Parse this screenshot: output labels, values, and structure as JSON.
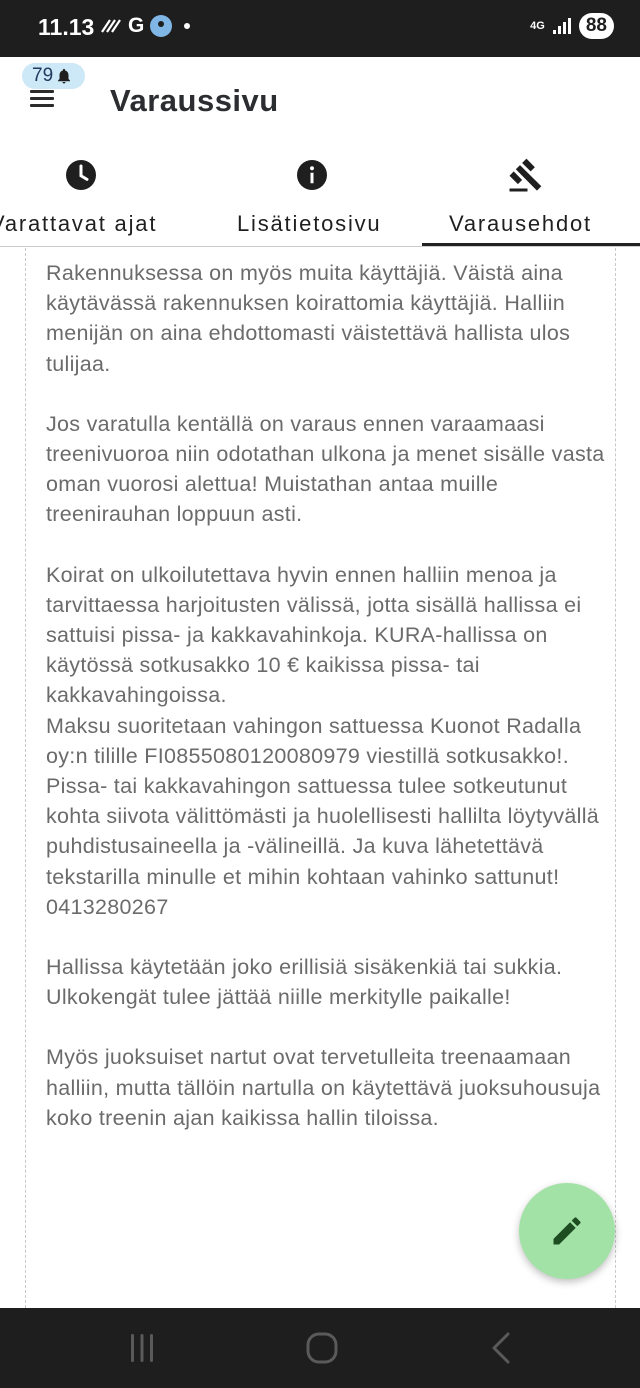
{
  "status_bar": {
    "time": "11.13",
    "left_icons": [
      "data-saver-icon",
      "google-icon",
      "location-icon",
      "dot"
    ],
    "g_label": "G",
    "network": "4G",
    "battery": "88"
  },
  "app_bar": {
    "notification_count": "79",
    "title": "Varaussivu"
  },
  "tabs": [
    {
      "label": "Varattavat ajat",
      "icon": "clock-icon",
      "selected": false
    },
    {
      "label": "Lisätietosivu",
      "icon": "info-icon",
      "selected": false
    },
    {
      "label": "Varausehdot",
      "icon": "gavel-icon",
      "selected": true
    }
  ],
  "content": {
    "paragraphs": [
      "Rakennuksessa on myös muita käyttäjiä. Väistä aina käytävässä rakennuksen koirattomia käyttäjiä. Halliin menijän on aina ehdottomasti väistettävä hallista ulos tulijaa.",
      "Jos varatulla kentällä on varaus ennen varaamaasi treenivuoroa niin odotathan ulkona ja menet sisälle vasta oman vuorosi alettua! Muistathan antaa muille treenirauhan loppuun asti.",
      "Koirat on ulkoilutettava hyvin ennen halliin menoa ja tarvittaessa harjoitusten välissä, jotta sisällä hallissa ei sattuisi pissa- ja kakkavahinkoja. KURA-hallissa on käytössä sotkusakko 10 € kaikissa pissa- tai kakkavahingoissa.\n Maksu suoritetaan vahingon sattuessa Kuonot Radalla oy:n tilille FI0855080120080979 viestillä sotkusakko!. Pissa- tai kakkavahingon sattuessa tulee sotkeutunut kohta siivota välittömästi ja huolellisesti hallilta löytyvällä puhdistusaineella ja -välineillä. Ja kuva lähetettävä tekstarilla minulle et mihin kohtaan vahinko sattunut! 0413280267",
      "Hallissa käytetään joko erillisiä sisäkenkiä tai sukkia. Ulkokengät tulee jättää niille merkitylle paikalle!",
      "Myös juoksuiset nartut ovat tervetulleita treenaamaan halliin, mutta tällöin nartulla on käytettävä juoksuhousuja koko treenin ajan kaikissa hallin tiloissa."
    ]
  },
  "fab": {
    "icon": "edit-icon"
  },
  "colors": {
    "status_bar_bg": "#1e1e1e",
    "badge_bg": "#cde8f7",
    "fab_bg": "#a3e2a6",
    "fab_icon": "#1e4d22",
    "body_text": "#6b6b6b",
    "tab_indicator": "#222222"
  },
  "nav_bar": {
    "buttons": [
      "recent-apps-icon",
      "home-icon",
      "back-icon"
    ]
  }
}
